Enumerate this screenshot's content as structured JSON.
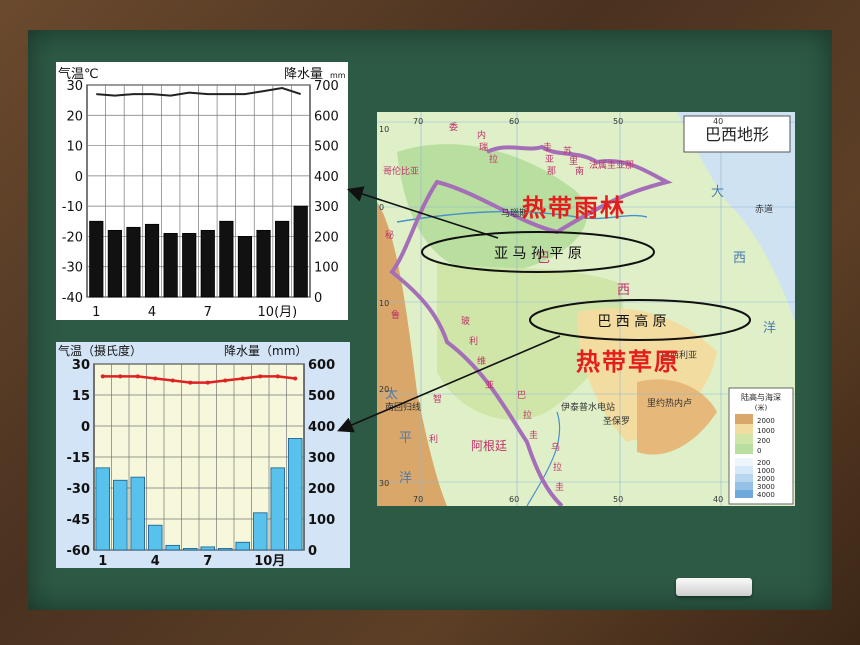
{
  "labels": {
    "rainforest": "热带雨林",
    "grassland": "热带草原",
    "amazon_plain": "亚 马 孙 平 原",
    "brazil_plateau": "巴 西 高 原"
  },
  "map": {
    "title": "巴西地形",
    "place_names": [
      "委",
      "内",
      "瑞",
      "拉",
      "圭",
      "亚",
      "那",
      "苏",
      "里",
      "南",
      "法属圭亚那",
      "哥伦比亚",
      "马瑙斯",
      "赤道",
      "大",
      "西",
      "洋",
      "秘",
      "鲁",
      "玻",
      "利",
      "维",
      "亚",
      "巴",
      "西",
      "巴西利亚",
      "巴",
      "拉",
      "圭",
      "阿根廷",
      "智",
      "利",
      "伊泰普水电站",
      "里约热内卢",
      "圣保罗",
      "南回归线",
      "平",
      "洋",
      "太",
      "乌",
      "拉",
      "圭"
    ],
    "legend_title": "陆高与海深",
    "legend_unit": "(米)",
    "legend_land": [
      "2000",
      "1000",
      "200",
      "0"
    ],
    "legend_sea": [
      "200",
      "1000",
      "2000",
      "3000",
      "4000"
    ],
    "lon_labels": [
      "70",
      "60",
      "50",
      "40",
      "70",
      "60",
      "50",
      "40"
    ],
    "lat_labels": [
      "10",
      "0",
      "10",
      "20",
      "30"
    ]
  },
  "colors": {
    "rainforest_bar": "#111111",
    "grassland_bar": "#58c2ec",
    "temp_line_1": "#222222",
    "temp_line_2": "#dd2222",
    "label_red": "#e41d1d"
  },
  "chart_data": [
    {
      "type": "bar",
      "title": "",
      "left_axis_label": "气温℃",
      "right_axis_label": "降水量",
      "right_axis_unit": "mm",
      "categories": [
        "1",
        "2",
        "3",
        "4",
        "5",
        "6",
        "7",
        "8",
        "9",
        "10",
        "11",
        "12"
      ],
      "x_tick_labels": [
        "1",
        "4",
        "7",
        "10(月)"
      ],
      "series": [
        {
          "name": "降水量",
          "kind": "bar",
          "values": [
            250,
            220,
            230,
            240,
            210,
            210,
            220,
            250,
            200,
            220,
            250,
            300
          ],
          "axis": "right"
        },
        {
          "name": "气温",
          "kind": "line",
          "values": [
            27,
            26.5,
            27,
            27,
            26.5,
            27.5,
            27,
            27,
            27,
            28,
            29,
            27
          ],
          "axis": "left"
        }
      ],
      "left_ticks": [
        "30",
        "20",
        "10",
        "0",
        "-10",
        "-20",
        "-30",
        "-40"
      ],
      "right_ticks": [
        "700",
        "600",
        "500",
        "400",
        "300",
        "200",
        "100",
        "0"
      ],
      "ylim_left": [
        -40,
        30
      ],
      "ylim_right": [
        0,
        700
      ]
    },
    {
      "type": "bar",
      "title": "",
      "left_axis_label": "气温（摄氏度）",
      "right_axis_label": "降水量（mm）",
      "categories": [
        "1",
        "2",
        "3",
        "4",
        "5",
        "6",
        "7",
        "8",
        "9",
        "10",
        "11",
        "12"
      ],
      "x_tick_labels": [
        "1",
        "4",
        "7",
        "10月"
      ],
      "series": [
        {
          "name": "降水量",
          "kind": "bar",
          "values": [
            265,
            225,
            235,
            80,
            15,
            5,
            10,
            5,
            25,
            120,
            265,
            360
          ],
          "axis": "right"
        },
        {
          "name": "气温",
          "kind": "line",
          "values": [
            24,
            24,
            24,
            23,
            22,
            21,
            21,
            22,
            23,
            24,
            24,
            23
          ],
          "axis": "left"
        }
      ],
      "left_ticks": [
        "30",
        "15",
        "0",
        "-15",
        "-30",
        "-45",
        "-60"
      ],
      "right_ticks": [
        "600",
        "500",
        "400",
        "300",
        "200",
        "100",
        "0"
      ],
      "ylim_left": [
        -60,
        30
      ],
      "ylim_right": [
        0,
        600
      ]
    }
  ]
}
